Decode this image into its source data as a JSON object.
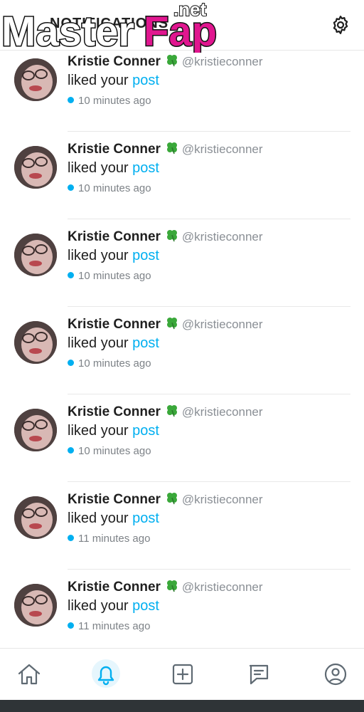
{
  "header": {
    "title": "NOTIFICATIONS",
    "watermark_text": "MasterFap",
    "watermark_suffix": ".net"
  },
  "notifications": [
    {
      "name": "Kristie Conner",
      "handle": "@kristieconner",
      "action": "liked your",
      "link": "post",
      "time": "10 minutes ago"
    },
    {
      "name": "Kristie Conner",
      "handle": "@kristieconner",
      "action": "liked your",
      "link": "post",
      "time": "10 minutes ago"
    },
    {
      "name": "Kristie Conner",
      "handle": "@kristieconner",
      "action": "liked your",
      "link": "post",
      "time": "10 minutes ago"
    },
    {
      "name": "Kristie Conner",
      "handle": "@kristieconner",
      "action": "liked your",
      "link": "post",
      "time": "10 minutes ago"
    },
    {
      "name": "Kristie Conner",
      "handle": "@kristieconner",
      "action": "liked your",
      "link": "post",
      "time": "10 minutes ago"
    },
    {
      "name": "Kristie Conner",
      "handle": "@kristieconner",
      "action": "liked your",
      "link": "post",
      "time": "11 minutes ago"
    },
    {
      "name": "Kristie Conner",
      "handle": "@kristieconner",
      "action": "liked your",
      "link": "post",
      "time": "11 minutes ago"
    }
  ],
  "icons": {
    "settings": "gear-icon",
    "emoji": "four-leaf-clover-icon",
    "nav": [
      "home-icon",
      "bell-icon",
      "plus-square-icon",
      "message-icon",
      "profile-icon"
    ]
  },
  "colors": {
    "accent": "#00aff0",
    "watermark_magenta": "#e0168f"
  },
  "nav": {
    "active_index": 1
  }
}
